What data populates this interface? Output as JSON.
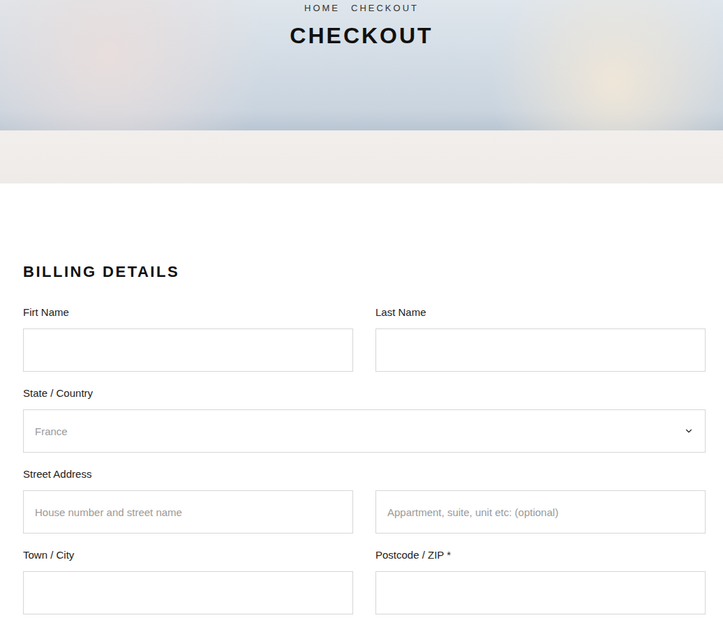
{
  "hero": {
    "breadcrumb": [
      "HOME",
      "CHECKOUT"
    ],
    "title": "CHECKOUT"
  },
  "billing": {
    "heading": "BILLING DETAILS",
    "rows": [
      {
        "kind": "pair",
        "fields": [
          {
            "label": "Firt Name",
            "placeholder": ""
          },
          {
            "label": "Last Name",
            "placeholder": ""
          }
        ]
      },
      {
        "kind": "select",
        "label": "State / Country",
        "value": "France"
      },
      {
        "kind": "address",
        "label": "Street Address",
        "placeholders": [
          "House number and street name",
          "Appartment, suite, unit etc: (optional)"
        ]
      },
      {
        "kind": "pair",
        "fields": [
          {
            "label": "Town / City",
            "placeholder": ""
          },
          {
            "label": "Postcode / ZIP *",
            "placeholder": ""
          }
        ]
      }
    ]
  }
}
